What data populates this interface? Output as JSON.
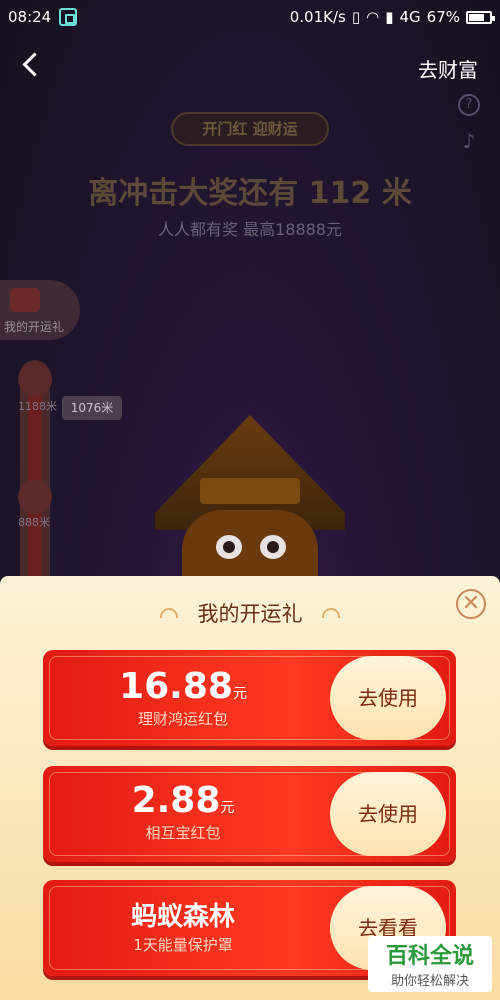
{
  "status_bar": {
    "time": "08:24",
    "network_speed": "0.01K/s",
    "network_type": "4G",
    "battery": "67%"
  },
  "header": {
    "back_icon": "chevron-left-icon",
    "right_link": "去财富"
  },
  "event": {
    "tag": "开门红 迎财运",
    "headline": "离冲击大奖还有 112 米",
    "subline": "人人都有奖 最高18888元"
  },
  "progress": {
    "gift_label": "我的开运礼",
    "node1_label": "1188米",
    "node2_label": "888米",
    "current_bubble": "1076米"
  },
  "sheet": {
    "title": "我的开运礼",
    "close_symbol": "✕",
    "cards": [
      {
        "amount": "16.88",
        "unit": "元",
        "desc": "理财鸿运红包",
        "action": "去使用"
      },
      {
        "amount": "2.88",
        "unit": "元",
        "desc": "相互宝红包",
        "action": "去使用"
      },
      {
        "amount": "蚂蚁森林",
        "unit": "",
        "desc": "1天能量保护罩",
        "action": "去看看"
      }
    ]
  },
  "watermark": {
    "title": "百科全说",
    "subtitle": "助你轻松解决"
  },
  "colors": {
    "card_red": "#e11b12",
    "sheet_bg": "#fdf3d8",
    "watermark_green": "#2a9a3a"
  }
}
